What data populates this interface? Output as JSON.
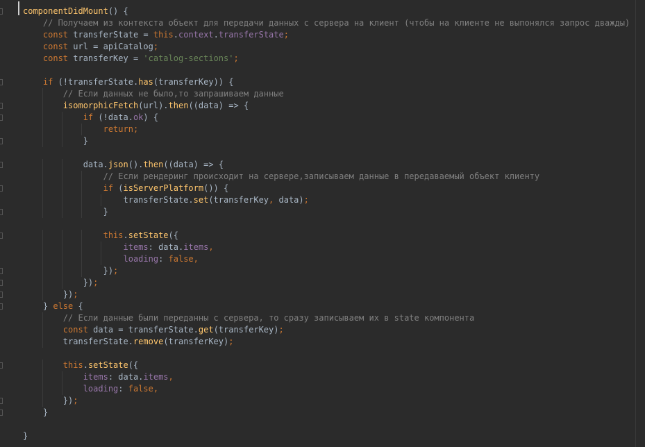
{
  "code": [
    [
      {
        "t": "componentDidMount",
        "c": "fn"
      },
      {
        "t": "() {",
        "c": "punc"
      }
    ],
    [
      {
        "t": "    // Получаем из контекста объект для передачи данных с сервера на клиент (чтобы на клиенте не выпонялся запрос дважды)",
        "c": "cmt"
      }
    ],
    [
      {
        "t": "    ",
        "c": "plain"
      },
      {
        "t": "const",
        "c": "kw"
      },
      {
        "t": " transferState = ",
        "c": "plain"
      },
      {
        "t": "this",
        "c": "kw"
      },
      {
        "t": ".",
        "c": "punc"
      },
      {
        "t": "context",
        "c": "prop"
      },
      {
        "t": ".",
        "c": "punc"
      },
      {
        "t": "transferState",
        "c": "prop"
      },
      {
        "t": ";",
        "c": "kw"
      }
    ],
    [
      {
        "t": "    ",
        "c": "plain"
      },
      {
        "t": "const",
        "c": "kw"
      },
      {
        "t": " url = apiCatalog",
        "c": "plain"
      },
      {
        "t": ";",
        "c": "kw"
      }
    ],
    [
      {
        "t": "    ",
        "c": "plain"
      },
      {
        "t": "const",
        "c": "kw"
      },
      {
        "t": " transferKey = ",
        "c": "plain"
      },
      {
        "t": "'catalog-sections'",
        "c": "str"
      },
      {
        "t": ";",
        "c": "kw"
      }
    ],
    [],
    [
      {
        "t": "    ",
        "c": "plain"
      },
      {
        "t": "if",
        "c": "kw"
      },
      {
        "t": " (!transferState.",
        "c": "plain"
      },
      {
        "t": "has",
        "c": "fn"
      },
      {
        "t": "(transferKey)) {",
        "c": "plain"
      }
    ],
    [
      {
        "t": "        // Если данных не было,то запрашиваем данные",
        "c": "cmt"
      }
    ],
    [
      {
        "t": "        ",
        "c": "plain"
      },
      {
        "t": "isomorphicFetch",
        "c": "fn"
      },
      {
        "t": "(url).",
        "c": "plain"
      },
      {
        "t": "then",
        "c": "fn"
      },
      {
        "t": "((data) => {",
        "c": "plain"
      }
    ],
    [
      {
        "t": "            ",
        "c": "plain"
      },
      {
        "t": "if",
        "c": "kw"
      },
      {
        "t": " (!data.",
        "c": "plain"
      },
      {
        "t": "ok",
        "c": "prop"
      },
      {
        "t": ") {",
        "c": "plain"
      }
    ],
    [
      {
        "t": "                ",
        "c": "plain"
      },
      {
        "t": "return",
        "c": "kw"
      },
      {
        "t": ";",
        "c": "kw"
      }
    ],
    [
      {
        "t": "            }",
        "c": "plain"
      }
    ],
    [],
    [
      {
        "t": "            data.",
        "c": "plain"
      },
      {
        "t": "json",
        "c": "fn"
      },
      {
        "t": "().",
        "c": "plain"
      },
      {
        "t": "then",
        "c": "fn"
      },
      {
        "t": "((data) => {",
        "c": "plain"
      }
    ],
    [
      {
        "t": "                // Если рендеринг происходит на сервере,записываем данные в передаваемый объект клиенту",
        "c": "cmt"
      }
    ],
    [
      {
        "t": "                ",
        "c": "plain"
      },
      {
        "t": "if",
        "c": "kw"
      },
      {
        "t": " (",
        "c": "plain"
      },
      {
        "t": "isServerPlatform",
        "c": "fn"
      },
      {
        "t": "()) {",
        "c": "plain"
      }
    ],
    [
      {
        "t": "                    transferState.",
        "c": "plain"
      },
      {
        "t": "set",
        "c": "fn"
      },
      {
        "t": "(transferKey",
        "c": "plain"
      },
      {
        "t": ",",
        "c": "kw"
      },
      {
        "t": " data)",
        "c": "plain"
      },
      {
        "t": ";",
        "c": "kw"
      }
    ],
    [
      {
        "t": "                }",
        "c": "plain"
      }
    ],
    [],
    [
      {
        "t": "                ",
        "c": "plain"
      },
      {
        "t": "this",
        "c": "kw"
      },
      {
        "t": ".",
        "c": "punc"
      },
      {
        "t": "setState",
        "c": "fn"
      },
      {
        "t": "({",
        "c": "plain"
      }
    ],
    [
      {
        "t": "                    ",
        "c": "plain"
      },
      {
        "t": "items",
        "c": "prop"
      },
      {
        "t": ": data.",
        "c": "plain"
      },
      {
        "t": "items",
        "c": "prop"
      },
      {
        "t": ",",
        "c": "kw"
      }
    ],
    [
      {
        "t": "                    ",
        "c": "plain"
      },
      {
        "t": "loading",
        "c": "prop"
      },
      {
        "t": ": ",
        "c": "plain"
      },
      {
        "t": "false",
        "c": "kw"
      },
      {
        "t": ",",
        "c": "kw"
      }
    ],
    [
      {
        "t": "                })",
        "c": "plain"
      },
      {
        "t": ";",
        "c": "kw"
      }
    ],
    [
      {
        "t": "            })",
        "c": "plain"
      },
      {
        "t": ";",
        "c": "kw"
      }
    ],
    [
      {
        "t": "        })",
        "c": "plain"
      },
      {
        "t": ";",
        "c": "kw"
      }
    ],
    [
      {
        "t": "    } ",
        "c": "plain"
      },
      {
        "t": "else",
        "c": "kw"
      },
      {
        "t": " {",
        "c": "plain"
      }
    ],
    [
      {
        "t": "        // Если данные были переданны с сервера, то сразу записываем их в state компонента",
        "c": "cmt"
      }
    ],
    [
      {
        "t": "        ",
        "c": "plain"
      },
      {
        "t": "const",
        "c": "kw"
      },
      {
        "t": " data = transferState.",
        "c": "plain"
      },
      {
        "t": "get",
        "c": "fn"
      },
      {
        "t": "(transferKey)",
        "c": "plain"
      },
      {
        "t": ";",
        "c": "kw"
      }
    ],
    [
      {
        "t": "        transferState.",
        "c": "plain"
      },
      {
        "t": "remove",
        "c": "fn"
      },
      {
        "t": "(transferKey)",
        "c": "plain"
      },
      {
        "t": ";",
        "c": "kw"
      }
    ],
    [],
    [
      {
        "t": "        ",
        "c": "plain"
      },
      {
        "t": "this",
        "c": "kw"
      },
      {
        "t": ".",
        "c": "punc"
      },
      {
        "t": "setState",
        "c": "fn"
      },
      {
        "t": "({",
        "c": "plain"
      }
    ],
    [
      {
        "t": "            ",
        "c": "plain"
      },
      {
        "t": "items",
        "c": "prop"
      },
      {
        "t": ": data.",
        "c": "plain"
      },
      {
        "t": "items",
        "c": "prop"
      },
      {
        "t": ",",
        "c": "kw"
      }
    ],
    [
      {
        "t": "            ",
        "c": "plain"
      },
      {
        "t": "loading",
        "c": "prop"
      },
      {
        "t": ": ",
        "c": "plain"
      },
      {
        "t": "false",
        "c": "kw"
      },
      {
        "t": ",",
        "c": "kw"
      }
    ],
    [
      {
        "t": "        })",
        "c": "plain"
      },
      {
        "t": ";",
        "c": "kw"
      }
    ],
    [
      {
        "t": "    }",
        "c": "plain"
      }
    ],
    [],
    [
      {
        "t": "}",
        "c": "plain"
      }
    ]
  ],
  "fold_marker_lines": [
    0,
    6,
    8,
    9,
    11,
    13,
    15,
    17,
    19,
    22,
    23,
    24,
    25,
    30,
    33,
    34
  ],
  "colors": {
    "background": "#2b2b2b",
    "keyword": "#cc7832",
    "function": "#ffc66d",
    "property": "#9876aa",
    "string": "#6a8759",
    "comment": "#808080",
    "text": "#a9b7c6"
  }
}
